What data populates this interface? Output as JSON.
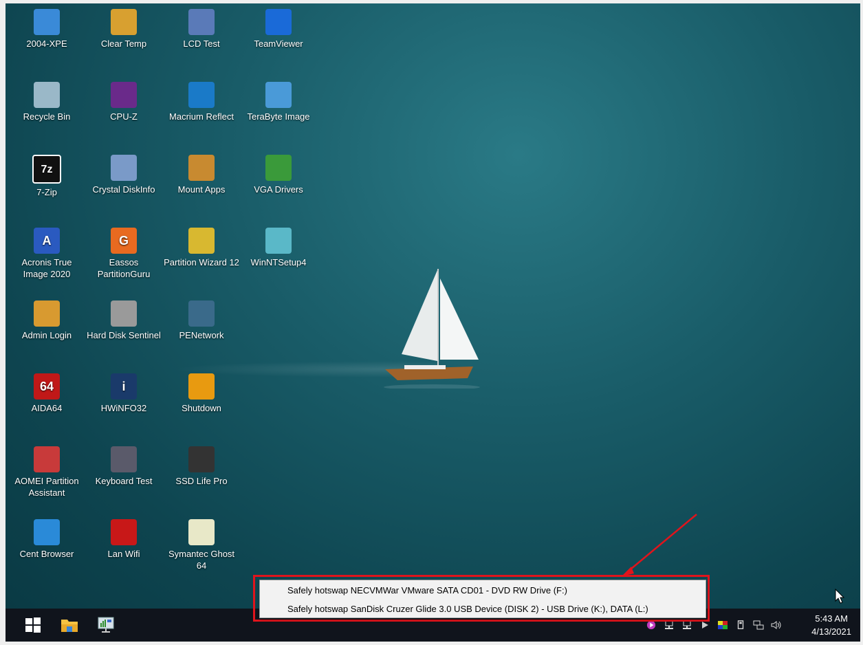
{
  "desktop_icons": [
    {
      "label": "2004-XPE",
      "icon": "computer-icon"
    },
    {
      "label": "Clear Temp",
      "icon": "broom-icon"
    },
    {
      "label": "LCD Test",
      "icon": "laptop-icon"
    },
    {
      "label": "TeamViewer",
      "icon": "teamviewer-icon"
    },
    {
      "label": "Recycle Bin",
      "icon": "recycle-bin-icon"
    },
    {
      "label": "CPU-Z",
      "icon": "cpu-chip-icon"
    },
    {
      "label": "Macrium Reflect",
      "icon": "macrium-icon"
    },
    {
      "label": "TeraByte Image",
      "icon": "terabyte-icon"
    },
    {
      "label": "7-Zip",
      "icon": "seven-zip-icon"
    },
    {
      "label": "Crystal DiskInfo",
      "icon": "disk-icon"
    },
    {
      "label": "Mount Apps",
      "icon": "apps-box-icon"
    },
    {
      "label": "VGA Drivers",
      "icon": "graphics-card-icon"
    },
    {
      "label": "Acronis True Image 2020",
      "icon": "acronis-icon"
    },
    {
      "label": "Eassos PartitionGuru",
      "icon": "partitionguru-icon"
    },
    {
      "label": "Partition Wizard 12",
      "icon": "wand-icon"
    },
    {
      "label": "WinNTSetup4",
      "icon": "setup-icon"
    },
    {
      "label": "Admin Login",
      "icon": "key-icon"
    },
    {
      "label": "Hard Disk Sentinel",
      "icon": "hard-disk-icon"
    },
    {
      "label": "PENetwork",
      "icon": "network-monitor-icon"
    },
    {
      "label": "",
      "icon": ""
    },
    {
      "label": "AIDA64",
      "icon": "aida64-icon"
    },
    {
      "label": "HWiNFO32",
      "icon": "hwinfo-icon"
    },
    {
      "label": "Shutdown",
      "icon": "power-icon"
    },
    {
      "label": "",
      "icon": ""
    },
    {
      "label": "AOMEI Partition Assistant",
      "icon": "aomei-icon"
    },
    {
      "label": "Keyboard Test",
      "icon": "keyboard-icon"
    },
    {
      "label": "SSD Life Pro",
      "icon": "ssd-chip-icon"
    },
    {
      "label": "",
      "icon": ""
    },
    {
      "label": "Cent Browser",
      "icon": "browser-icon"
    },
    {
      "label": "Lan Wifi",
      "icon": "wifi-icon"
    },
    {
      "label": "Symantec Ghost 64",
      "icon": "ghost-icon"
    }
  ],
  "icon_glyphs": {
    "seven_zip": "7z",
    "aida": "64",
    "acronis": "A",
    "eassos": "G",
    "hwinfo": "i"
  },
  "context_menu": {
    "items": [
      "Safely hotswap NECVMWar VMware SATA CD01 - DVD RW Drive (F:)",
      "Safely hotswap SanDisk Cruzer Glide 3.0 USB Device (DISK 2) - USB Drive (K:), DATA (L:)"
    ]
  },
  "taskbar": {
    "pinned": [
      "start-icon",
      "file-explorer-icon",
      "network-monitor-icon"
    ],
    "clock_time": "5:43 AM",
    "clock_date": "4/13/2021"
  },
  "colors": {
    "annotation": "#e0141c",
    "taskbar": "#10141c",
    "sea": "#195c68"
  }
}
